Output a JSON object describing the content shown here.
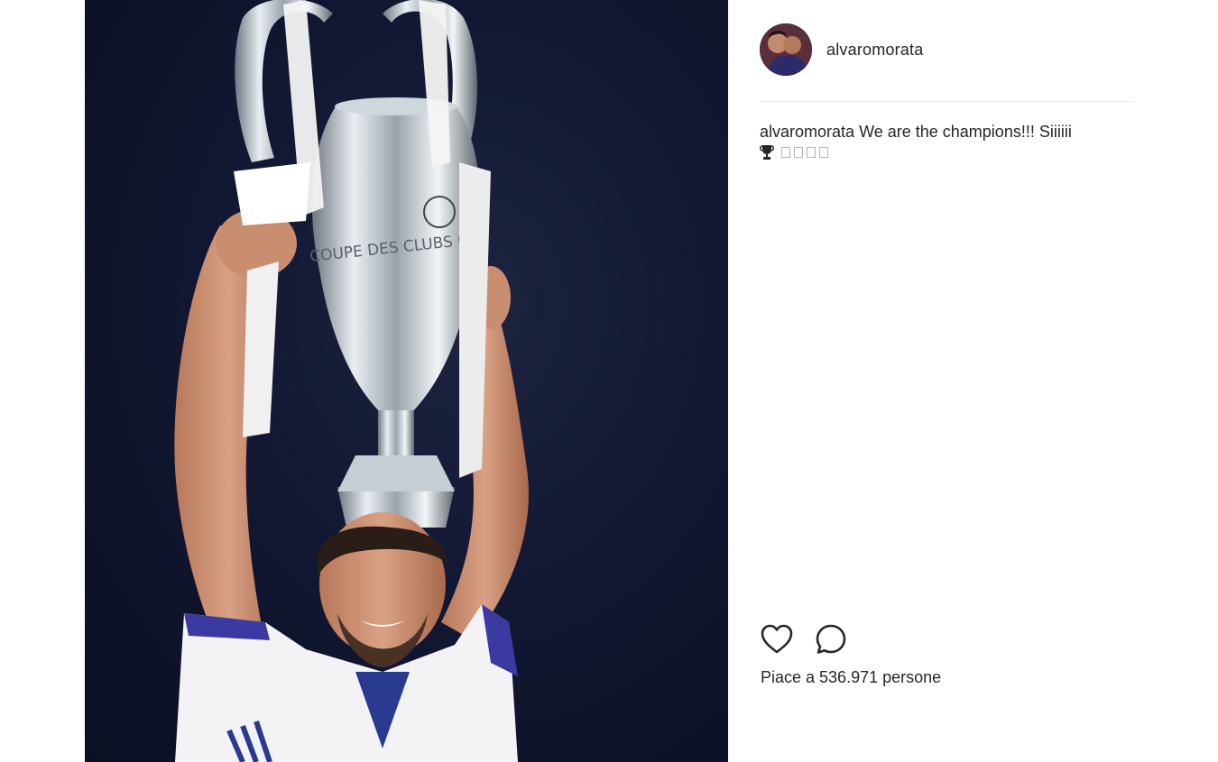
{
  "post": {
    "username": "alvaromorata",
    "caption": {
      "username": "alvaromorata",
      "text": "We are the champions!!! Siiiiii",
      "emoji_line": [
        "trophy-icon",
        "missing-glyph",
        "missing-glyph",
        "missing-glyph",
        "missing-glyph"
      ]
    },
    "actions": {
      "like_icon": "heart-icon",
      "comment_icon": "comment-bubble-icon"
    },
    "likes_text": "Piace a 536.971 persone"
  },
  "colors": {
    "text": "#262626",
    "divider": "#efefef",
    "photo_background": "#121833"
  }
}
